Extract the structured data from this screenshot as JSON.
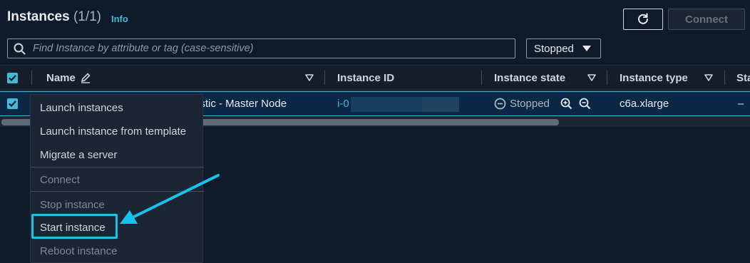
{
  "header": {
    "title": "Instances",
    "count": "(1/1)",
    "info_label": "Info",
    "connect_label": "Connect"
  },
  "search": {
    "placeholder": "Find Instance by attribute or tag (case-sensitive)"
  },
  "state_filter": {
    "selected": "Stopped"
  },
  "table": {
    "columns": [
      "Name",
      "Instance ID",
      "Instance state",
      "Instance type",
      "Sta"
    ],
    "row": {
      "name_visible": "astic - Master Node",
      "instance_id_prefix": "i-0",
      "state": "Stopped",
      "type": "c6a.xlarge",
      "status": "–"
    }
  },
  "context_menu": {
    "items": [
      {
        "label": "Launch instances",
        "enabled": true
      },
      {
        "label": "Launch instance from template",
        "enabled": true
      },
      {
        "label": "Migrate a server",
        "enabled": true
      },
      {
        "label": "Connect",
        "enabled": false
      },
      {
        "label": "Stop instance",
        "enabled": false
      },
      {
        "label": "Start instance",
        "enabled": true
      },
      {
        "label": "Reboot instance",
        "enabled": false
      }
    ]
  },
  "annotation": {
    "arrow_color": "#19c2ea",
    "highlight_target": "Start instance"
  },
  "colors": {
    "background": "#0f1b2a",
    "accent": "#44b9d6",
    "selected_row": "#0a2746"
  }
}
